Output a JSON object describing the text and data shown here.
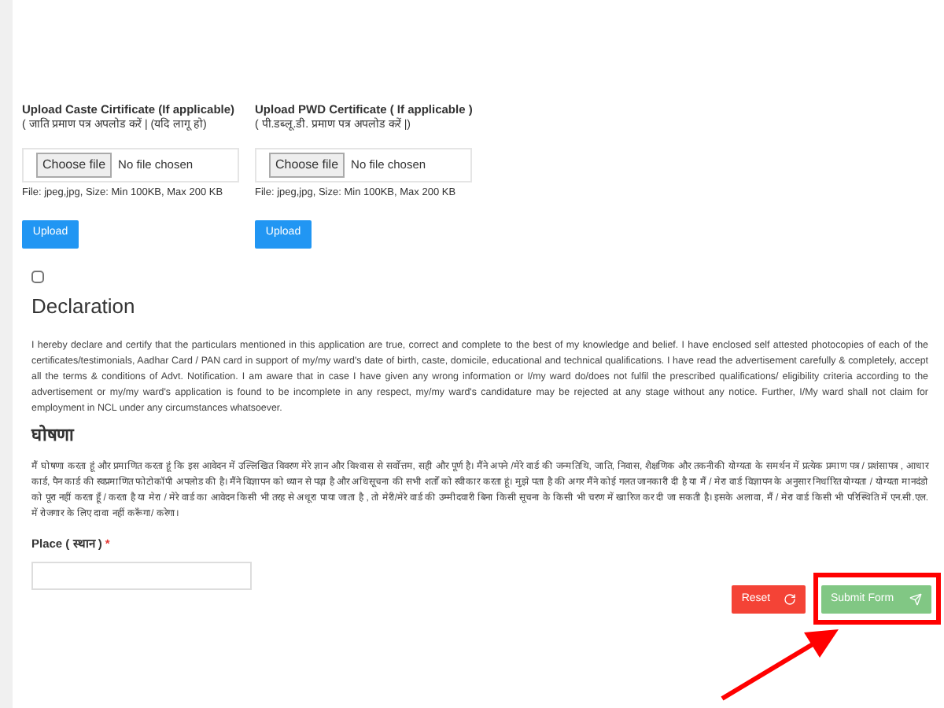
{
  "uploads": [
    {
      "label": "Upload Caste Cirtificate (If applicable)",
      "hint": "( जाति प्रमाण पत्र अपलोड करें | (यदि लागू हो)",
      "choose": "Choose file",
      "status": "No file chosen",
      "note": "File: jpeg,jpg, Size: Min 100KB, Max 200 KB",
      "button": "Upload"
    },
    {
      "label": "Upload PWD Certificate ( If applicable )",
      "hint": "( पी.डब्लू.डी. प्रमाण पत्र अपलोड करें |)",
      "choose": "Choose file",
      "status": "No file chosen",
      "note": "File: jpeg,jpg, Size: Min 100KB, Max 200 KB",
      "button": "Upload"
    }
  ],
  "declaration": {
    "checked": false,
    "title": "Declaration",
    "text": "I hereby declare and certify that the particulars mentioned in this application are true, correct and complete to the best of my knowledge and belief. I have enclosed self attested photocopies of each of the certificates/testimonials, Aadhar Card / PAN card in support of my/my ward's date of birth, caste, domicile, educational and technical qualifications. I have read the advertisement carefully & completely, accept all the terms & conditions of Advt. Notification. I am aware that in case I have given any wrong information or I/my ward do/does not fulfil the prescribed qualifications/ eligibility criteria according to the advertisement or my/my ward's application is found to be incomplete in any respect, my/my ward's candidature may be rejected at any stage without any notice. Further, I/My ward shall not claim for employment in NCL under any circumstances whatsoever.",
    "hindi_title": "घोषणा",
    "hindi_text": "मैं घोषणा करता हूं और प्रमाणित करता हूं कि इस आवेदन में उल्लिखित विवरण मेरे ज्ञान और विश्वास से सर्वोत्तम, सही और पूर्ण है। मैंने अपने /मेरे वार्ड की जन्मतिथि, जाति, निवास, शैक्षणिक और तकनीकी योग्यता के समर्थन में प्रत्येक प्रमाण पत्र / प्रशंसापत्र , आधार कार्ड, पैन कार्ड की स्वप्रमाणित फोटोकॉपी अपलोड की है। मैंने विज्ञापन को ध्यान से पढ़ा है और अधिसूचना की सभी शर्तों को स्वीकार करता हूं। मुझे पता है की अगर मैंने कोई गलत जानकारी दी है या मैं / मेरा वार्ड विज्ञापन के अनुसार निर्धारित योग्यता / योग्यता मानदंडो को पूरा नहीं करता हूँ / करता है या मेरा / मेरे वार्ड का आवेदन किसी भी तरह से अधूरा पाया जाता है , तो मेरी/मेरे वार्ड की उम्मीदवारी बिना किसी सूचना के किसी भी चरण में खारिज कर दी जा सकती है। इसके अलावा, मैं / मेरा वार्ड किसी भी परिस्थिति में एन.सी.एल. में रोजगार के लिए दावा नहीं करूँगा/ करेगा।"
  },
  "place": {
    "label": "Place ( स्थान )",
    "required": "*"
  },
  "buttons": {
    "reset": "Reset",
    "submit": "Submit Form"
  }
}
